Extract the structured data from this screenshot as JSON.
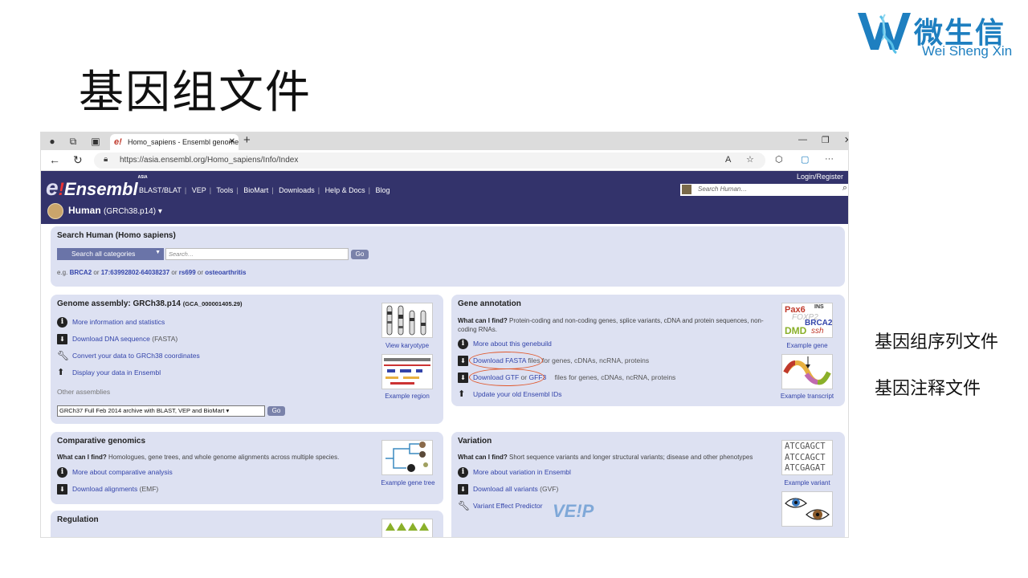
{
  "slide": {
    "title": "基因组文件",
    "note1": "基因组序列文件",
    "note2": "基因注释文件"
  },
  "logo": {
    "cn": "微生信",
    "en": "Wei Sheng Xin",
    "color": "#1e7fc0"
  },
  "browser": {
    "tab_title": "Homo_sapiens - Ensembl genome",
    "url": "https://asia.ensembl.org/Homo_sapiens/Info/Index"
  },
  "ensembl": {
    "logo_e": "e",
    "logo_bang": "!",
    "logo_text": "Ensembl",
    "logo_sub": "ASIA",
    "nav": [
      "BLAST/BLAT",
      "VEP",
      "Tools",
      "BioMart",
      "Downloads",
      "Help & Docs",
      "Blog"
    ],
    "login": "Login/Register",
    "search_placeholder": "Search Human…",
    "species_name": "Human",
    "species_assembly": "(GRCh38.p14) ▾",
    "header_color": "#33336b"
  },
  "search_panel": {
    "title": "Search Human (Homo sapiens)",
    "category": "Search all categories",
    "placeholder": "Search…",
    "go": "Go",
    "eg_prefix": "e.g.",
    "eg1": "BRCA2",
    "or": "or",
    "eg2": "17:63992802-64038237",
    "eg3": "rs699",
    "eg4": "osteoarthritis"
  },
  "genome_panel": {
    "title": "Genome assembly: GRCh38.p14",
    "title_small": "(GCA_000001405.29)",
    "links": [
      "More information and statistics",
      "Download DNA sequence",
      "Convert your data to GRCh38 coordinates",
      "Display your data in Ensembl"
    ],
    "fasta_suffix": "(FASTA)",
    "other_assemblies": "Other assemblies",
    "select_value": "GRCh37 Full Feb 2014 archive with BLAST, VEP and BioMart ▾",
    "go": "Go",
    "karyotype_caption": "View karyotype",
    "region_caption": "Example region"
  },
  "annot_panel": {
    "title": "Gene annotation",
    "what_label": "What can I find?",
    "what_text": "Protein-coding and non-coding genes, splice variants, cDNA and protein sequences, non-coding RNAs.",
    "link1": "More about this genebuild",
    "link2": "Download FASTA",
    "link2_rest": "files for genes, cDNAs, ncRNA, proteins",
    "link3a": "Download GTF",
    "link3b": "or",
    "link3c": "GFF3",
    "link3_rest": "files for genes, cDNAs, ncRNA, proteins",
    "link4": "Update your old Ensembl IDs",
    "gene_caption": "Example gene",
    "transcript_caption": "Example transcript",
    "gene_thumb_words": [
      "Pax6",
      "INS",
      "FOXP2",
      "BRCA2",
      "DMD",
      "ssh"
    ]
  },
  "comp_panel": {
    "title": "Comparative genomics",
    "what_label": "What can I find?",
    "what_text": "Homologues, gene trees, and whole genome alignments across multiple species.",
    "link1": "More about comparative analysis",
    "link2": "Download alignments",
    "link2_suffix": "(EMF)",
    "caption": "Example gene tree"
  },
  "var_panel": {
    "title": "Variation",
    "what_label": "What can I find?",
    "what_text": "Short sequence variants and longer structural variants; disease and other phenotypes",
    "link1": "More about variation in Ensembl",
    "link2": "Download all variants",
    "link2_suffix": "(GVF)",
    "link3": "Variant Effect Predictor",
    "vep_logo": "VE!P",
    "caption": "Example variant",
    "dna_lines": [
      "ATCGAGCT",
      "ATCCAGCT",
      "ATCGAGAT"
    ]
  },
  "reg_panel": {
    "title": "Regulation"
  }
}
